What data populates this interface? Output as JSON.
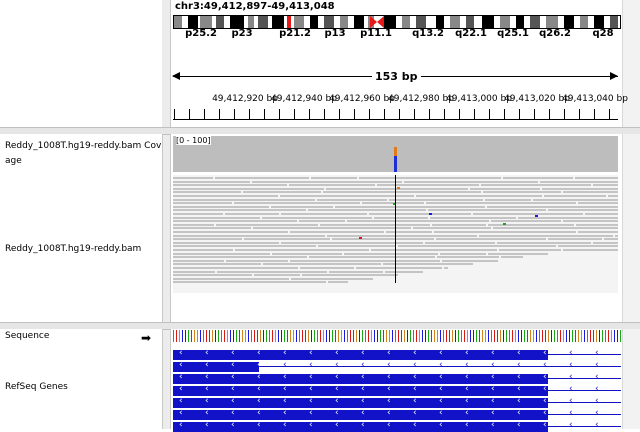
{
  "header": {
    "locus": "chr3:49,412,897-49,413,048",
    "span_label": "153 bp",
    "cytobands": [
      "p25.2",
      "p23",
      "p21.2",
      "p13",
      "p11.1",
      "q13.2",
      "q22.1",
      "q25.1",
      "q26.2",
      "q28"
    ],
    "ruler_ticks": [
      "49,412,920 bp",
      "49,412,940 bp",
      "49,412,960 bp",
      "49,412,980 bp",
      "49,413,000 bp",
      "49,413,020 bp",
      "49,413,040 bp"
    ]
  },
  "tracks": {
    "coverage_name": "Reddy_1008T.hg19-reddy.bam Coverage",
    "coverage_name_line1": "Reddy_1008T.hg19-reddy.bam Cov",
    "coverage_name_line2": "age",
    "coverage_range": "[0 - 100]",
    "alignment_name": "Reddy_1008T.hg19-reddy.bam",
    "sequence_name": "Sequence",
    "sequence_strand_icon": "arrow-right-icon",
    "genes_name": "RefSeq Genes"
  },
  "colors": {
    "gene": "#1212c8",
    "coverage": "#bdbdbd",
    "mismatch_orange": "#e07b1a",
    "mismatch_blue": "#1f2fd6",
    "centromere": "#e81818",
    "base_A": "#1aa81a",
    "base_C": "#1a1ad8",
    "base_G": "#d1861a",
    "base_T": "#d81a1a"
  }
}
